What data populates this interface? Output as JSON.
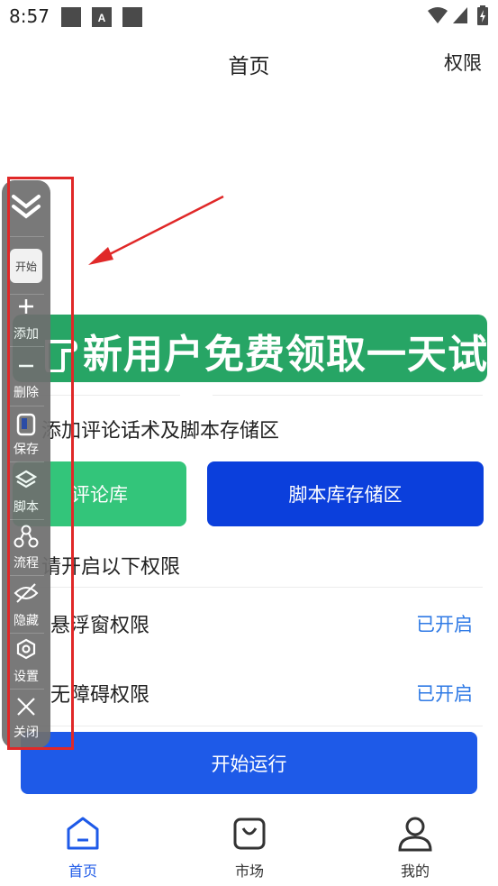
{
  "status_bar": {
    "time": "8:57"
  },
  "header": {
    "title": "首页",
    "permission_link": "权限"
  },
  "banner": {
    "text": "新用户免费领取一天试用"
  },
  "storage": {
    "title": "添加评论话术及脚本存储区",
    "comment_button": "评论库",
    "script_button": "脚本库存储区"
  },
  "permissions": {
    "title": "请开启以下权限",
    "items": [
      {
        "label": "悬浮窗权限",
        "status": "已开启"
      },
      {
        "label": "无障碍权限",
        "status": "已开启"
      }
    ]
  },
  "start_button": "开始运行",
  "toolbar": {
    "start_label": "开始",
    "items": [
      {
        "label": "添加",
        "icon": "plus-icon"
      },
      {
        "label": "删除",
        "icon": "minus-icon"
      },
      {
        "label": "保存",
        "icon": "save-icon"
      },
      {
        "label": "脚本",
        "icon": "layers-icon"
      },
      {
        "label": "流程",
        "icon": "flow-icon"
      },
      {
        "label": "隐藏",
        "icon": "eye-off-icon"
      },
      {
        "label": "设置",
        "icon": "settings-icon"
      },
      {
        "label": "关闭",
        "icon": "close-icon"
      }
    ]
  },
  "bottom_nav": {
    "items": [
      {
        "label": "首页",
        "icon": "home-icon",
        "active": true
      },
      {
        "label": "市场",
        "icon": "bag-icon",
        "active": false
      },
      {
        "label": "我的",
        "icon": "user-icon",
        "active": false
      }
    ]
  },
  "colors": {
    "accent_blue": "#1e5ae8",
    "banner_green": "#27a565",
    "comment_green": "#33c57a",
    "script_blue": "#0b3fdc",
    "status_blue": "#2f7ae5",
    "highlight_red": "#e02828"
  }
}
